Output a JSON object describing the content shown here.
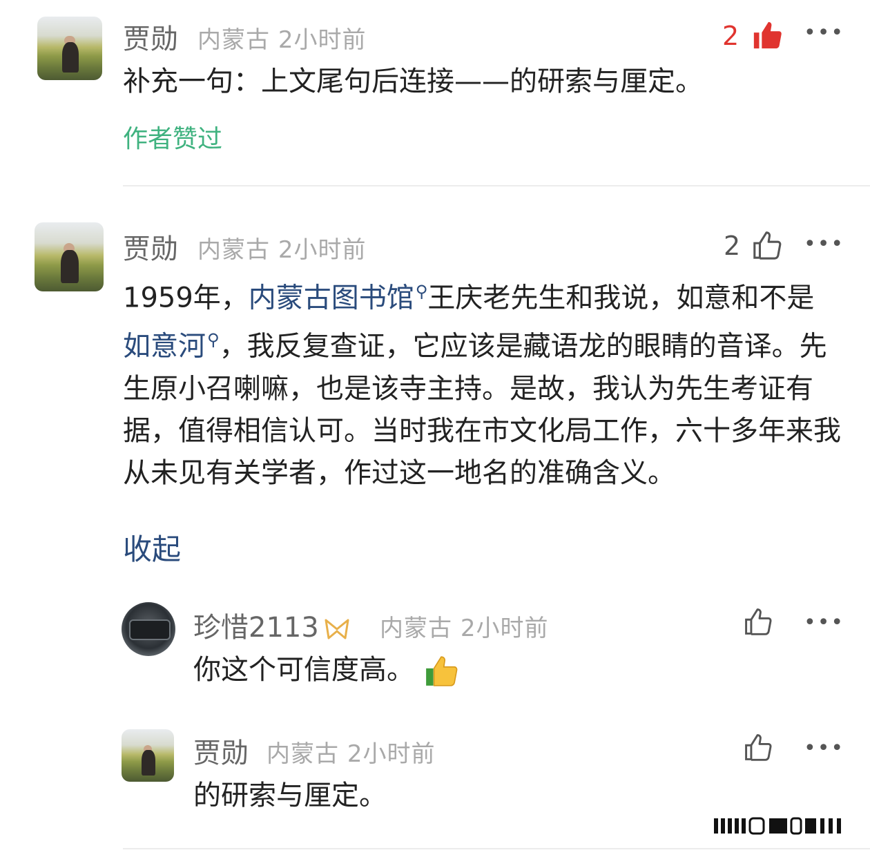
{
  "comments": [
    {
      "author": "贾勋",
      "region": "内蒙古",
      "time": "2小时前",
      "likes": "2",
      "liked": true,
      "text": "补充一句：上文尾句后连接——的研索与厘定。",
      "author_liked_label": "作者赞过"
    },
    {
      "author": "贾勋",
      "region": "内蒙古",
      "time": "2小时前",
      "likes": "2",
      "liked": false,
      "text_parts": [
        "1959年，",
        "内蒙古图书馆",
        "王庆老先生和我说，如意和不是",
        "如意河",
        "，我反复查证，它应该是藏语龙的眼睛的音译。先生原小召喇嘛，也是该寺主持。是故，我认为先生考证有据，值得相信认可。当时我在市文化局工作，六十多年来我从未见有关学者，作过这一地名的准确含义。"
      ],
      "collapse_label": "收起",
      "replies": [
        {
          "author": "珍惜2113",
          "region": "内蒙古",
          "time": "2小时前",
          "text": "你这个可信度高。"
        },
        {
          "author": "贾勋",
          "region": "内蒙古",
          "time": "2小时前",
          "text": "的研索与厘定。"
        }
      ]
    }
  ],
  "colors": {
    "like_active": "#e0342f",
    "author_liked": "#3fb27f",
    "link": "#2a4b7c",
    "meta": "#a9a9a9"
  },
  "icons": [
    "thumbs-up-filled-icon",
    "thumbs-up-outline-icon",
    "more-dots-icon",
    "search-icon",
    "badge-icon",
    "thumbs-up-emoji-icon",
    "watermark-logo"
  ]
}
